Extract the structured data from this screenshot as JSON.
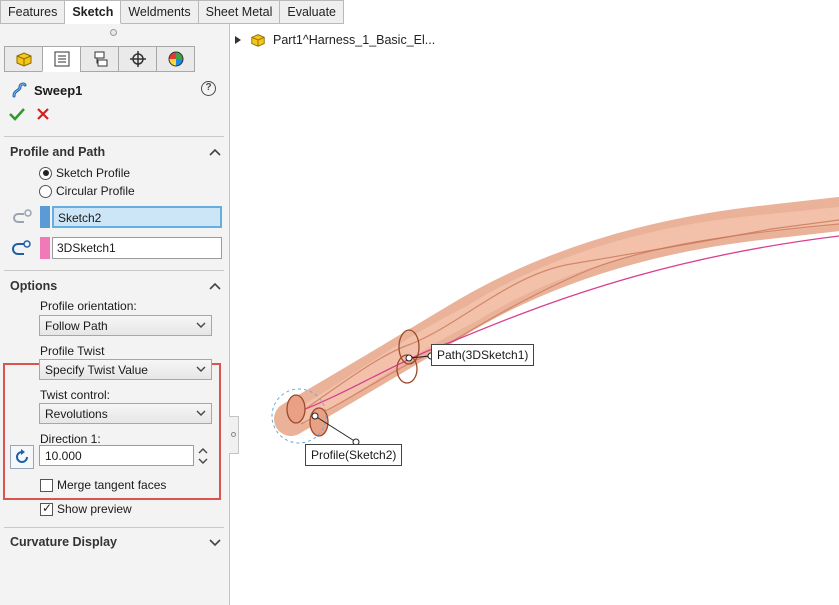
{
  "command_tabs": [
    "Features",
    "Sketch",
    "Weldments",
    "Sheet Metal",
    "Evaluate"
  ],
  "active_command_tab": "Sketch",
  "manager_tabs": [
    "feature-manager-tab",
    "property-manager-tab",
    "configuration-manager-tab",
    "dimxpert-manager-tab",
    "display-manager-tab"
  ],
  "feature": {
    "title": "Sweep1",
    "help": "?"
  },
  "profile_and_path": {
    "heading": "Profile and Path",
    "options": [
      {
        "label": "Sketch Profile",
        "selected": true
      },
      {
        "label": "Circular Profile",
        "selected": false
      }
    ],
    "profile_selection": "Sketch2",
    "path_selection": "3DSketch1",
    "profile_color": "#5b9bd5",
    "path_color": "#f07ab8"
  },
  "options_section": {
    "heading": "Options",
    "profile_orientation_label": "Profile orientation:",
    "profile_orientation_value": "Follow Path",
    "profile_twist_label": "Profile Twist",
    "profile_twist_value": "Specify Twist Value",
    "twist_control_label": "Twist control:",
    "twist_control_value": "Revolutions",
    "direction_label": "Direction 1:",
    "direction_value": "10.000",
    "merge_tangent_faces": {
      "label": "Merge tangent faces",
      "checked": false
    },
    "show_preview": {
      "label": "Show preview",
      "checked": true
    }
  },
  "curvature_section": {
    "heading": "Curvature Display"
  },
  "viewport": {
    "tree_item": "Part1^Harness_1_Basic_El...",
    "path_callout": "Path(3DSketch1)",
    "profile_callout": "Profile(Sketch2)"
  },
  "colors": {
    "highlight_border": "#d9534f",
    "sweep_fill": "#f2b49b",
    "accept": "#2e9a2e",
    "cancel": "#d22020"
  }
}
